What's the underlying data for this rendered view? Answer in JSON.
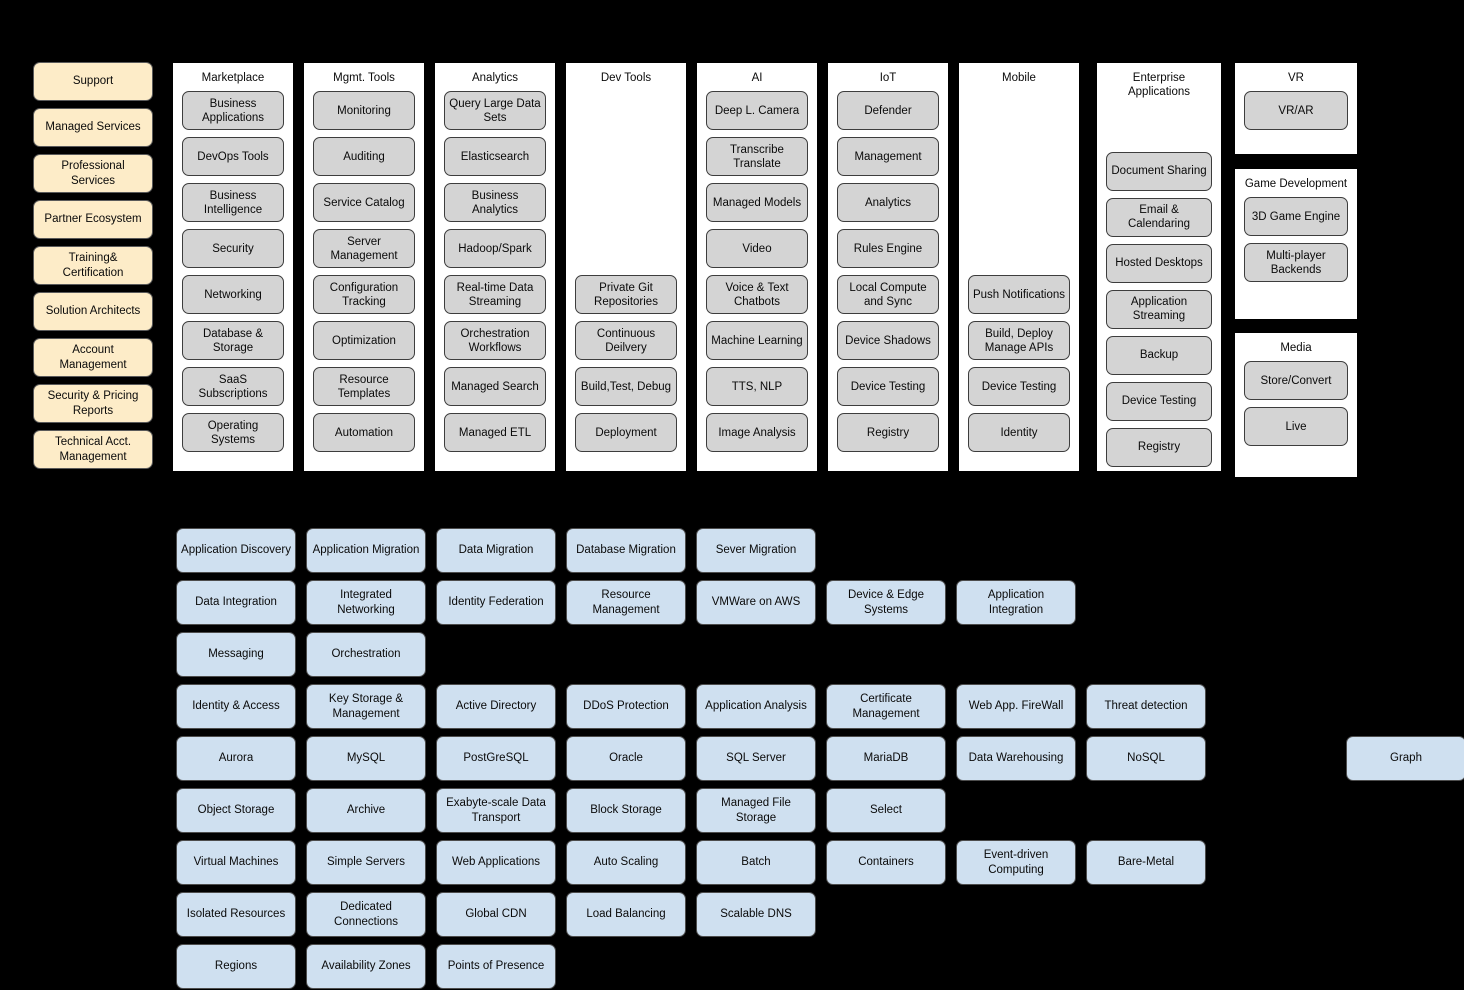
{
  "colors": {
    "background": "#000000",
    "support_fill": "#fdecc8",
    "category_card_fill": "#ffffff",
    "service_fill": "#d4d4d4",
    "blue_fill": "#cfe0f0",
    "border": "#3d3d3d",
    "text": "#0a0a0a"
  },
  "support_column": {
    "items": [
      {
        "label": "Support"
      },
      {
        "label": "Managed Services"
      },
      {
        "label": "Professional Services"
      },
      {
        "label": "Partner Ecosystem"
      },
      {
        "label": "Training& Certification"
      },
      {
        "label": "Solution Architects"
      },
      {
        "label": "Account Management"
      },
      {
        "label": "Security & Pricing Reports"
      },
      {
        "label": "Technical Acct. Management"
      }
    ]
  },
  "categories": [
    {
      "title": "Marketplace",
      "items": [
        "Business Applications",
        "DevOps Tools",
        "Business Intelligence",
        "Security",
        "Networking",
        "Database & Storage",
        "SaaS Subscriptions",
        "Operating Systems"
      ]
    },
    {
      "title": "Mgmt. Tools",
      "items": [
        "Monitoring",
        "Auditing",
        "Service Catalog",
        "Server Management",
        "Configuration Tracking",
        "Optimization",
        "Resource Templates",
        "Automation"
      ]
    },
    {
      "title": "Analytics",
      "items": [
        "Query Large Data Sets",
        "Elasticsearch",
        "Business Analytics",
        "Hadoop/Spark",
        "Real-time Data Streaming",
        "Orchestration Workflows",
        "Managed Search",
        "Managed ETL"
      ]
    },
    {
      "title": "Dev Tools",
      "pad_top": 4,
      "items": [
        "Private Git Repositories",
        "Continuous Deilvery",
        "Build,Test, Debug",
        "Deployment"
      ]
    },
    {
      "title": "AI",
      "items": [
        "Deep L. Camera",
        "Transcribe Translate",
        "Managed Models",
        "Video",
        "Voice & Text Chatbots",
        "Machine Learning",
        "TTS, NLP",
        "Image Analysis"
      ]
    },
    {
      "title": "IoT",
      "items": [
        "Defender",
        "Management",
        "Analytics",
        "Rules Engine",
        "Local Compute and Sync",
        "Device Shadows",
        "Device Testing",
        "Registry"
      ]
    },
    {
      "title": "Mobile",
      "pad_top": 4,
      "items": [
        "Push Notifications",
        "Build, Deploy Manage APIs",
        "Device Testing",
        "Identity"
      ]
    },
    {
      "title": "Enterprise Applications",
      "pad_top": 1,
      "items": [
        "Document Sharing",
        "Email & Calendaring",
        "Hosted Desktops",
        "Application Streaming",
        "Backup",
        "Device Testing",
        "Registry"
      ]
    }
  ],
  "right_stack": [
    {
      "title": "VR",
      "items": [
        "VR/AR"
      ]
    },
    {
      "title": "Game Development",
      "items": [
        "3D Game Engine",
        "Multi-player Backends"
      ]
    },
    {
      "title": "Media",
      "items": [
        "Store/Convert",
        "Live"
      ]
    }
  ],
  "blue_grid": {
    "rows": [
      [
        "Application Discovery",
        "Application Migration",
        "Data Migration",
        "Database Migration",
        "Sever Migration"
      ],
      [
        "Data Integration",
        "Integrated Networking",
        "Identity Federation",
        "Resource Management",
        "VMWare on AWS",
        "Device & Edge Systems",
        "Application Integration"
      ],
      [
        "Messaging",
        "Orchestration"
      ],
      [
        "Identity & Access",
        "Key Storage & Management",
        "Active Directory",
        "DDoS Protection",
        "Application Analysis",
        "Certificate Management",
        "Web App. FireWall",
        "Threat detection"
      ],
      [
        "Aurora",
        "MySQL",
        "PostGreSQL",
        "Oracle",
        "SQL Server",
        "MariaDB",
        "Data Warehousing",
        "NoSQL",
        "",
        "Graph"
      ],
      [
        "Object Storage",
        "Archive",
        "Exabyte-scale Data Transport",
        "Block Storage",
        "Managed File Storage",
        "Select"
      ],
      [
        "Virtual Machines",
        "Simple Servers",
        "Web Applications",
        "Auto Scaling",
        "Batch",
        "Containers",
        "Event-driven Computing",
        "Bare-Metal"
      ],
      [
        "Isolated Resources",
        "Dedicated Connections",
        "Global CDN",
        "Load Balancing",
        "Scalable DNS"
      ],
      [
        "Regions",
        "Availability Zones",
        "Points of Presence"
      ]
    ]
  }
}
